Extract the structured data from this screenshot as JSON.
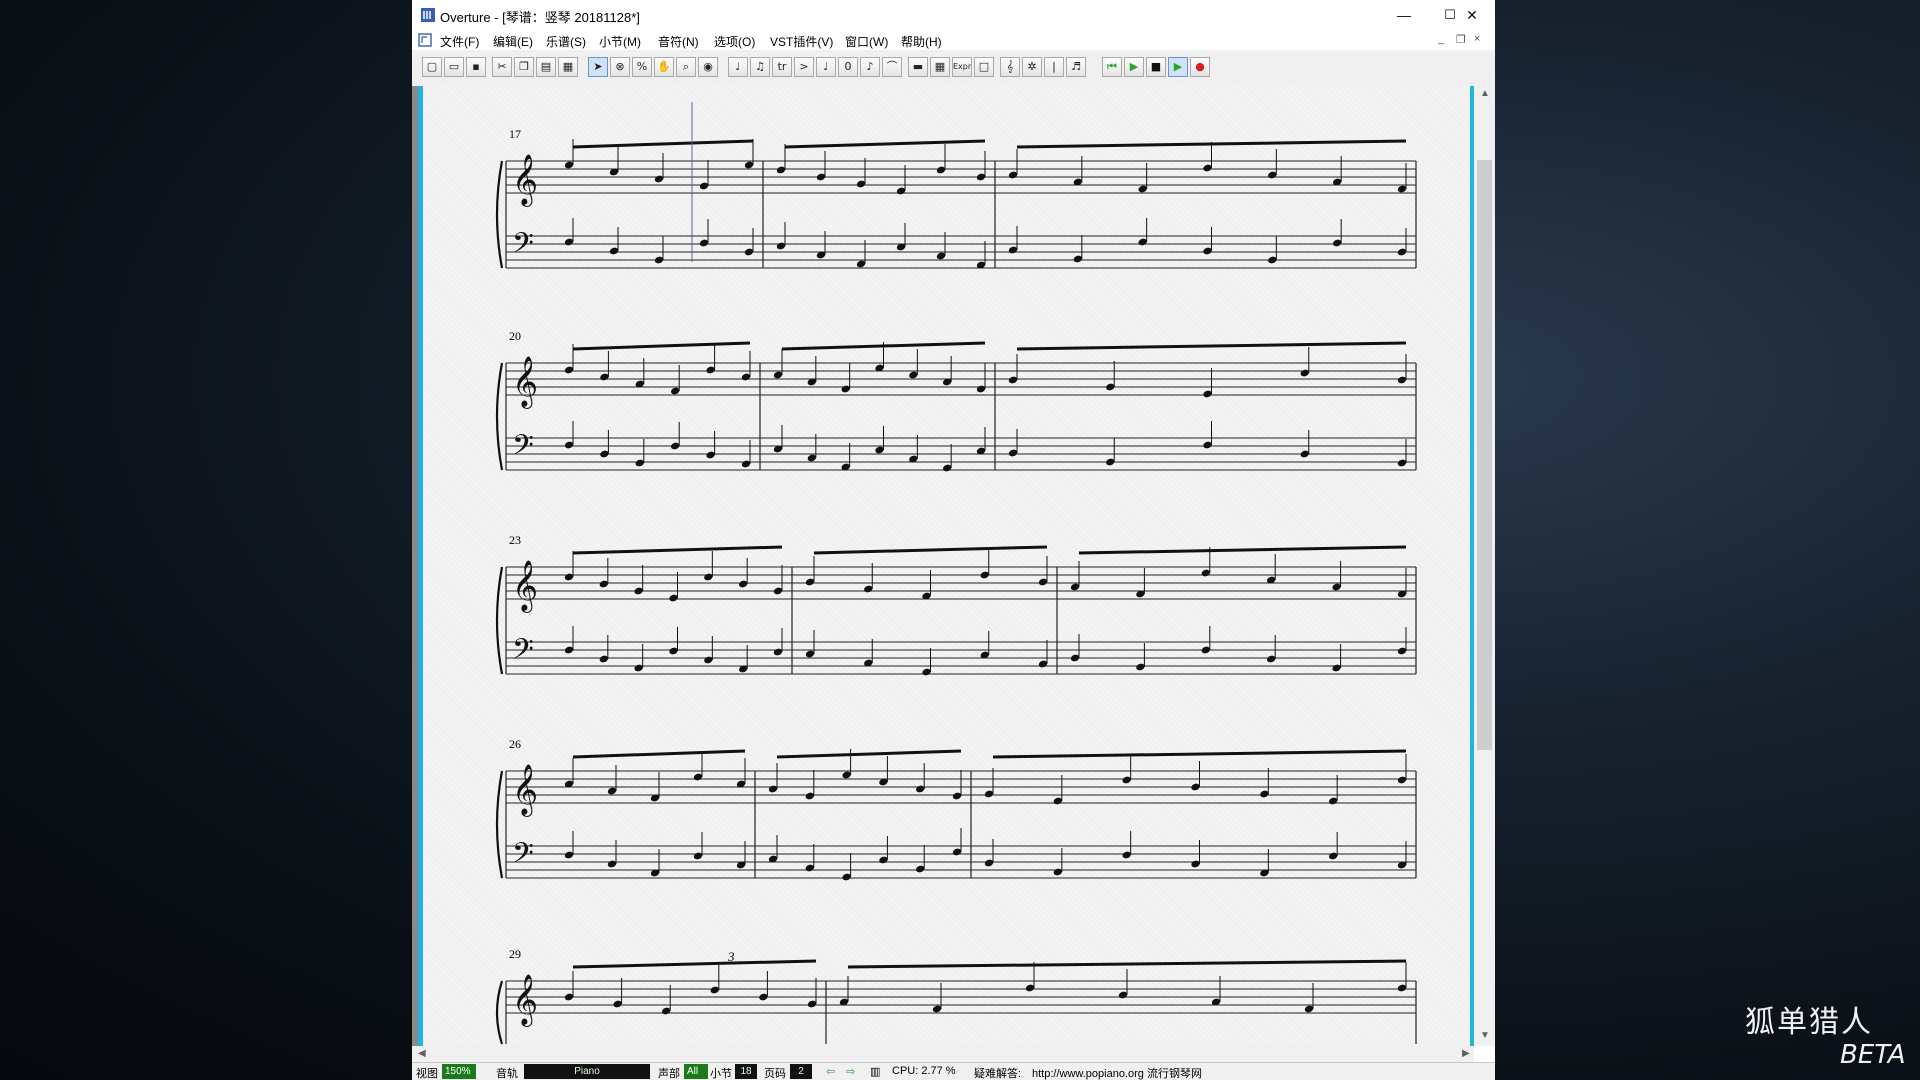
{
  "window": {
    "title": "Overture - [琴谱：竖琴 20181128*]",
    "minimize": "—",
    "maximize": "☐",
    "close": "✕"
  },
  "menu": {
    "items": [
      "文件(F)",
      "编辑(E)",
      "乐谱(S)",
      "小节(M)",
      "音符(N)",
      "选项(O)",
      "VST插件(V)",
      "窗口(W)",
      "帮助(H)"
    ],
    "mdi_minimize": "_",
    "mdi_restore": "❐",
    "mdi_close": "×"
  },
  "toolbar": {
    "buttons": [
      "new",
      "open",
      "save",
      "cut",
      "copy",
      "paste",
      "print",
      "select",
      "erase",
      "percent",
      "hand",
      "zoom",
      "color",
      "quarter-note",
      "two-notes",
      "trill",
      "accent",
      "note",
      "zero",
      "dot-note",
      "slur",
      "hairpin",
      "table",
      "Expr",
      "rectangle",
      "treble-clef",
      "tuning",
      "barline",
      "cue-note",
      "rewind",
      "play",
      "stop",
      "play-green",
      "record"
    ],
    "expr_label": "Expr",
    "zero_label": "0"
  },
  "score": {
    "measure_numbers": [
      "17",
      "20",
      "23",
      "26",
      "29"
    ],
    "triplet_label": "3"
  },
  "status": {
    "view_label": "视图",
    "zoom": "150%",
    "track_label": "音轨",
    "instrument": "Piano",
    "voice_label": "声部",
    "voice_value": "All",
    "measure_label": "小节",
    "measure_value": "18",
    "page_label": "页码",
    "page_value": "2",
    "cpu": "CPU: 2.77 %",
    "help_label": "疑难解答:",
    "help_url": "http://www.popiano.org 流行钢琴网"
  },
  "watermark": {
    "line1": "狐单猎人",
    "line2": "BETA"
  },
  "colors": {
    "accent_bar": "#22b3e2",
    "status_green": "#1a7a1a",
    "play_green": "#29a329",
    "record_red": "#d42020"
  }
}
